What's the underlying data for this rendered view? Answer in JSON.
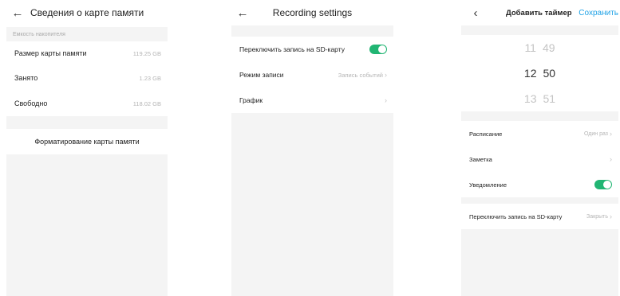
{
  "screen1": {
    "title": "Сведения о карте памяти",
    "section_label": "Емкость накопителя",
    "rows": [
      {
        "label": "Размер карты памяти",
        "value": "119.25 GB"
      },
      {
        "label": "Занято",
        "value": "1.23 GB"
      },
      {
        "label": "Свободно",
        "value": "118.02 GB"
      }
    ],
    "format_label": "Форматирование карты памяти"
  },
  "screen2": {
    "title": "Recording settings",
    "toggle_label": "Переключить запись на SD-карту",
    "mode_label": "Режим записи",
    "mode_value": "Запись событий",
    "schedule_label": "График"
  },
  "screen3": {
    "title": "Добавить таймер",
    "save_label": "Сохранить",
    "picker": [
      {
        "h": "11",
        "m": "49"
      },
      {
        "h": "12",
        "m": "50"
      },
      {
        "h": "13",
        "m": "51"
      }
    ],
    "rows": [
      {
        "label": "Расписание",
        "value": "Один раз"
      },
      {
        "label": "Заметка",
        "value": ""
      }
    ],
    "notify_label": "Уведомление",
    "switch_label": "Переключить запись на SD-карту",
    "switch_value": "Закрыть"
  },
  "colors": {
    "accent": "#21b573",
    "link": "#1fa2e6",
    "bg_gray": "#f4f4f4"
  }
}
